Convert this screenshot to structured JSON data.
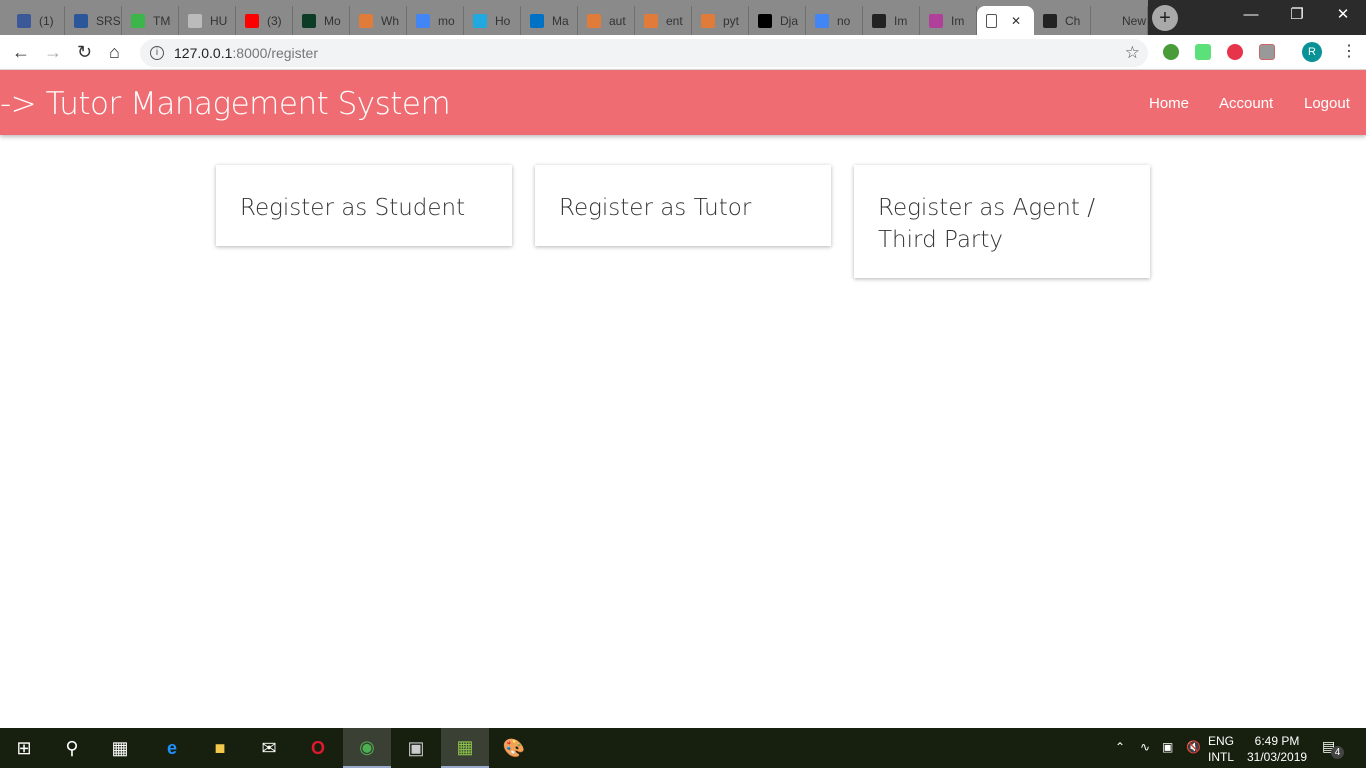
{
  "browser": {
    "tabs": [
      {
        "label": "(1)",
        "color": "#3b5998"
      },
      {
        "label": "SRS",
        "color": "#2b579a"
      },
      {
        "label": "TM",
        "color": "#3cb54a"
      },
      {
        "label": "HU",
        "color": "#bbb"
      },
      {
        "label": "(3)",
        "color": "#ff0000"
      },
      {
        "label": "Mo",
        "color": "#0c3c26"
      },
      {
        "label": "Wh",
        "color": "#e07b39"
      },
      {
        "label": "mo",
        "color": "#4285f4"
      },
      {
        "label": "Ho",
        "color": "#1fa9e0"
      },
      {
        "label": "Ma",
        "color": "#0072c6"
      },
      {
        "label": "aut",
        "color": "#e07b39"
      },
      {
        "label": "ent",
        "color": "#e07b39"
      },
      {
        "label": "pyt",
        "color": "#e07b39"
      },
      {
        "label": "Dja",
        "color": "#000"
      },
      {
        "label": "no",
        "color": "#4285f4"
      },
      {
        "label": "Im",
        "color": "#222"
      },
      {
        "label": "Im",
        "color": "#b0409a"
      },
      {
        "label": "",
        "color": "#fff",
        "active": true
      },
      {
        "label": "Ch",
        "color": "#222"
      },
      {
        "label": "New Ta",
        "color": "#8a8a8a"
      }
    ],
    "new_tab": "+",
    "url_host": "127.0.0.1",
    "url_path": ":8000/register",
    "profile": "R"
  },
  "app": {
    "brand": "-> Tutor Management System",
    "nav": [
      "Home",
      "Account",
      "Logout"
    ],
    "accent": "#ef6d72",
    "cards": [
      "Register as Student",
      "Register as Tutor",
      "Register as Agent / Third Party"
    ]
  },
  "taskbar": {
    "lang1": "ENG",
    "lang2": "INTL",
    "time": "6:49 PM",
    "date": "31/03/2019",
    "notifications": "4"
  }
}
